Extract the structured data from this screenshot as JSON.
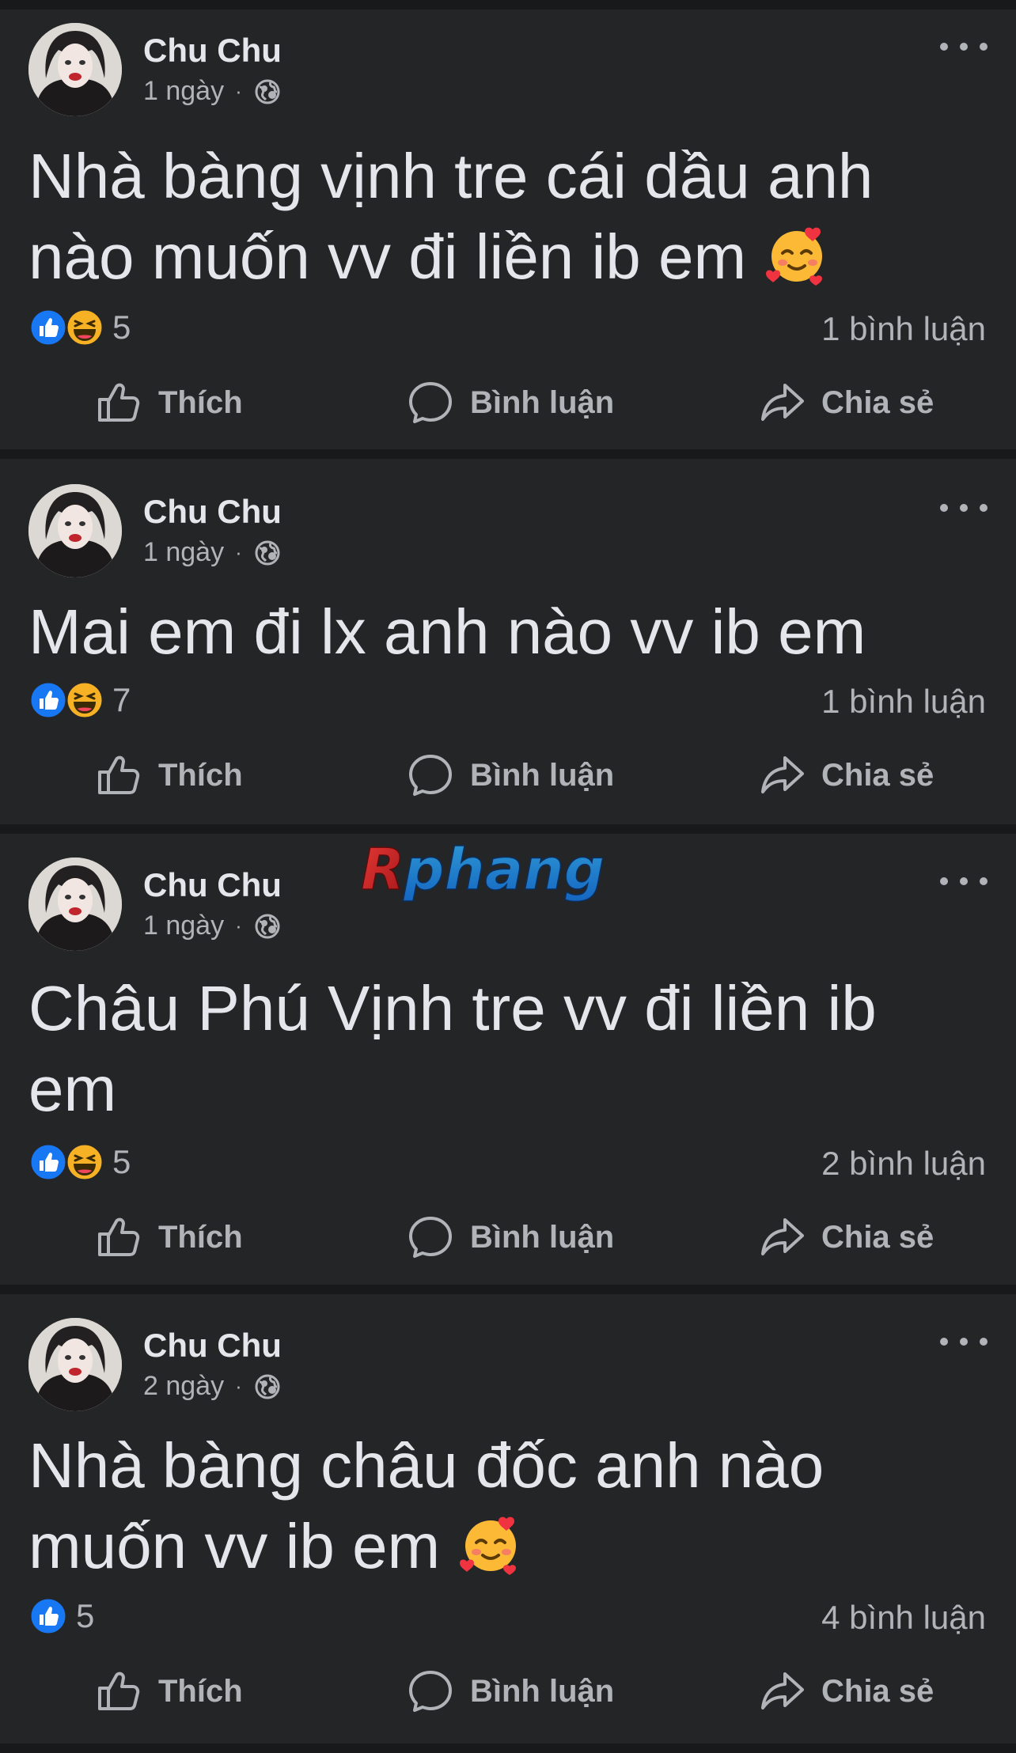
{
  "posts": [
    {
      "author": "Chu Chu",
      "time": "1 ngày",
      "separator": "·",
      "text": "Nhà bàng vịnh tre cái dầu anh nào muốn vv đi liền ib em",
      "emoji": "smiling-face-with-hearts",
      "reactions": [
        "like",
        "haha"
      ],
      "reaction_count": "5",
      "comments": "1 bình luận",
      "actions": {
        "like": "Thích",
        "comment": "Bình luận",
        "share": "Chia sẻ"
      }
    },
    {
      "author": "Chu Chu",
      "time": "1 ngày",
      "separator": "·",
      "text": "Mai em đi lx anh nào vv ib em",
      "reactions": [
        "like",
        "haha"
      ],
      "reaction_count": "7",
      "comments": "1 bình luận",
      "actions": {
        "like": "Thích",
        "comment": "Bình luận",
        "share": "Chia sẻ"
      }
    },
    {
      "author": "Chu Chu",
      "time": "1 ngày",
      "separator": "·",
      "text": "Châu Phú Vịnh tre vv đi liền ib em",
      "reactions": [
        "like",
        "haha"
      ],
      "reaction_count": "5",
      "comments": "2 bình luận",
      "actions": {
        "like": "Thích",
        "comment": "Bình luận",
        "share": "Chia sẻ"
      }
    },
    {
      "author": "Chu Chu",
      "time": "2 ngày",
      "separator": "·",
      "text": "Nhà bàng châu đốc anh nào muốn vv ib em",
      "emoji": "smiling-face-with-hearts",
      "reactions": [
        "like"
      ],
      "reaction_count": "5",
      "comments": "4 bình luận",
      "actions": {
        "like": "Thích",
        "comment": "Bình luận",
        "share": "Chia sẻ"
      }
    }
  ],
  "watermark": "Rphang",
  "colors": {
    "background": "#18191a",
    "card": "#242526",
    "primary_text": "#e4e6eb",
    "secondary_text": "#b0b3b8",
    "like_blue": "#1877f2",
    "haha_yellow": "#f7b125"
  }
}
